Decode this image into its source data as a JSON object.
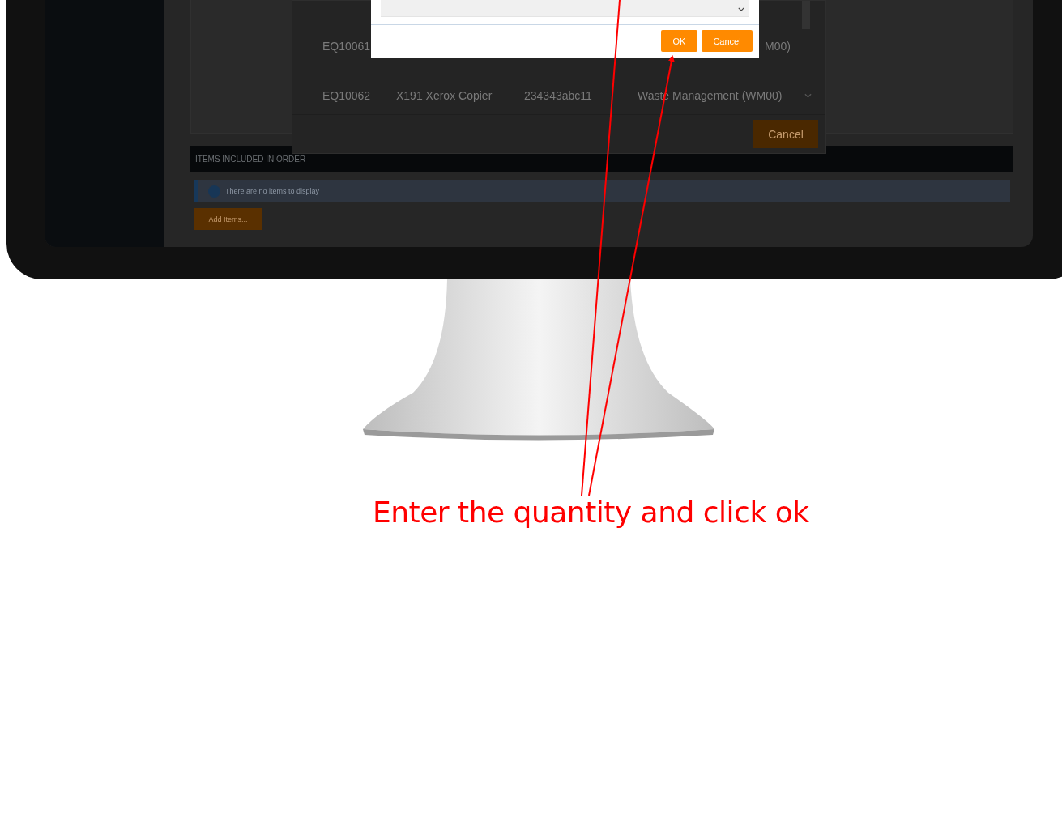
{
  "screen": {
    "dialog": {
      "rows": [
        {
          "id": "EQ10061",
          "department": "M00)"
        },
        {
          "id": "EQ10062",
          "name": "X191 Xerox Copier",
          "serial": "234343abc11",
          "department": "Waste Management (WM00)"
        }
      ],
      "cancel_button": "Cancel"
    },
    "quantity_modal": {
      "buttons": [
        "OK",
        "Cancel"
      ]
    },
    "items_section": {
      "title": "ITEMS INCLUDED IN ORDER",
      "info_message": "There are no items to display",
      "add_button": "Add Items..."
    }
  },
  "caption": "Enter the quantity and click ok"
}
